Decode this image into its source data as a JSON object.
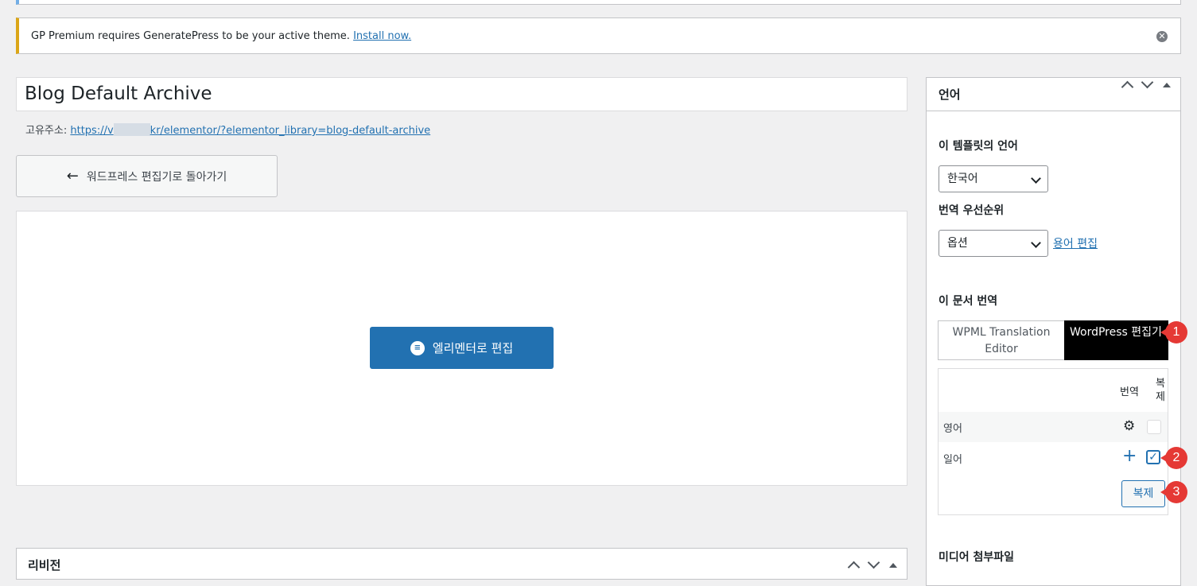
{
  "notice": {
    "text": "GP Premium requires GeneratePress to be your active theme.",
    "link": "Install now."
  },
  "post": {
    "title": "Blog Default Archive",
    "permalink_label": "고유주소:",
    "permalink_start": "https://v",
    "permalink_end": "kr/elementor/?elementor_library=blog-default-archive"
  },
  "buttons": {
    "back": "워드프레스 편집기로 돌아가기",
    "elementor": "엘리멘터로 편집"
  },
  "revisions": {
    "title": "리비전"
  },
  "language_box": {
    "title": "언어",
    "template_lang_label": "이 템플릿의 언어",
    "template_lang_value": "한국어",
    "priority_label": "번역 우선순위",
    "priority_value": "옵션",
    "edit_terms": "용어 편집",
    "translate_label": "이 문서 번역",
    "tab_wpml": "WPML Translation Editor",
    "tab_wp": "WordPress 편집기",
    "col_translate": "번역",
    "col_duplicate": "복제",
    "rows": [
      {
        "lang": "영어",
        "icon": "gear-icon",
        "checked": false
      },
      {
        "lang": "일어",
        "icon": "plus-icon",
        "checked": true
      }
    ],
    "duplicate_button": "복제"
  },
  "media_box": {
    "title": "미디어 첨부파일"
  },
  "badges": [
    "1",
    "2",
    "3"
  ],
  "colors": {
    "accent": "#2271b1",
    "badge": "#e53935",
    "notice_warning": "#dba617",
    "tab_active": "#000000"
  }
}
